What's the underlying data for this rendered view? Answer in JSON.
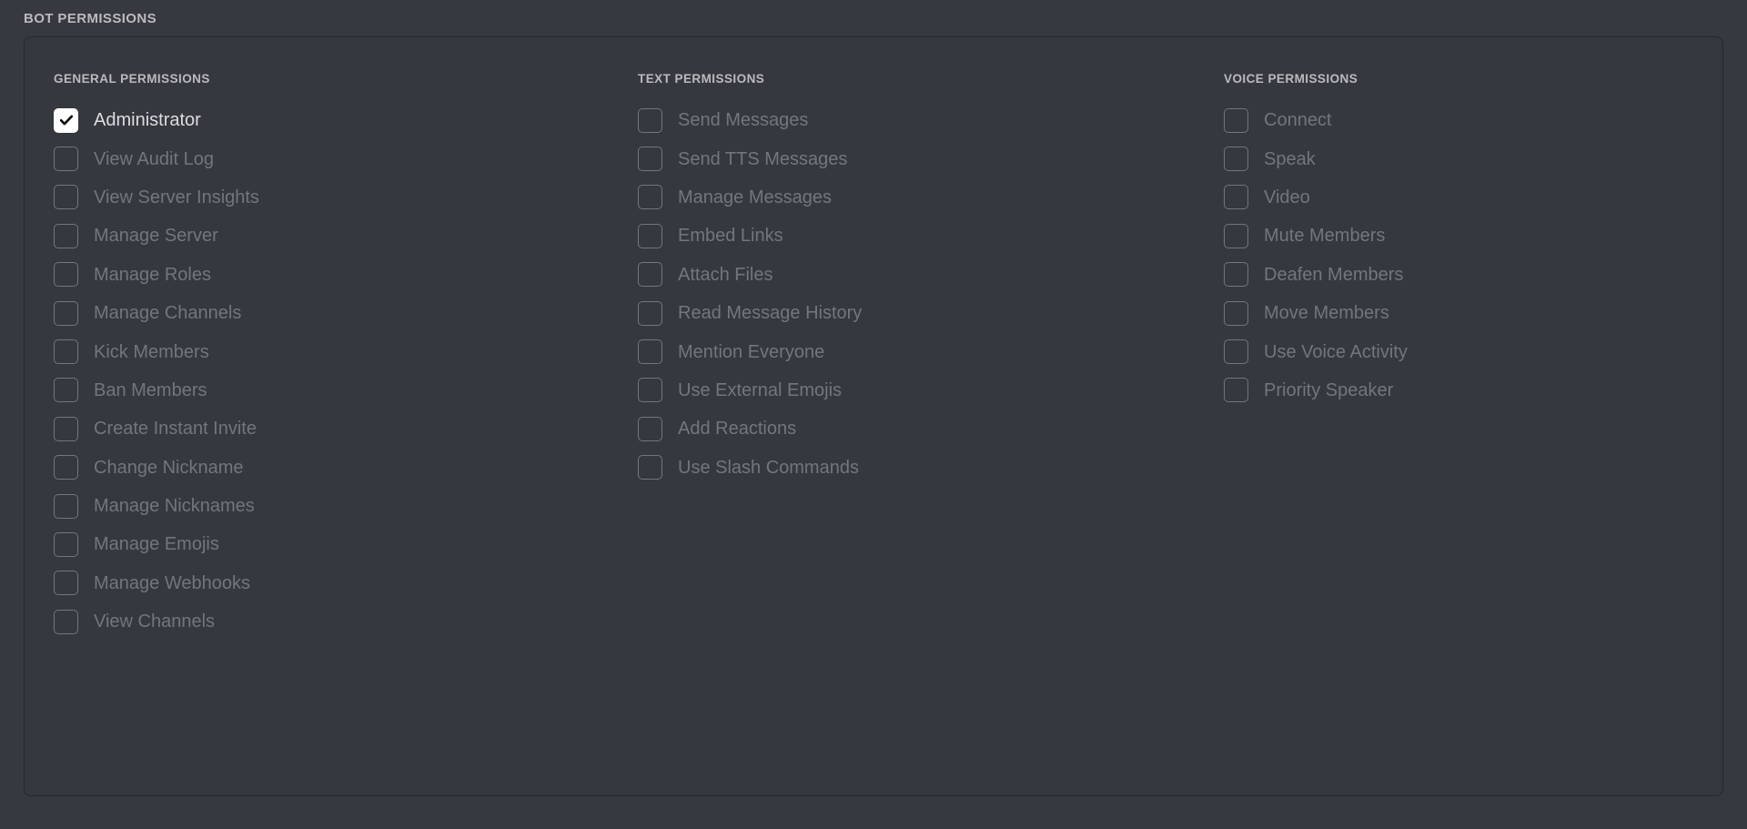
{
  "section": {
    "title": "BOT PERMISSIONS"
  },
  "colors": {
    "page_background": "#36393f",
    "panel_background": "#35383e",
    "panel_border": "#26282c",
    "heading_text": "#b9bbbe",
    "label_disabled": "#72767d",
    "label_enabled": "#dcddde",
    "checkbox_border": "#72767d",
    "checkbox_checked_fill": "#ffffff",
    "checkmark": "#000000"
  },
  "columns": [
    {
      "heading": "GENERAL PERMISSIONS",
      "items": [
        {
          "label": "Administrator",
          "checked": true
        },
        {
          "label": "View Audit Log",
          "checked": false
        },
        {
          "label": "View Server Insights",
          "checked": false
        },
        {
          "label": "Manage Server",
          "checked": false
        },
        {
          "label": "Manage Roles",
          "checked": false
        },
        {
          "label": "Manage Channels",
          "checked": false
        },
        {
          "label": "Kick Members",
          "checked": false
        },
        {
          "label": "Ban Members",
          "checked": false
        },
        {
          "label": "Create Instant Invite",
          "checked": false
        },
        {
          "label": "Change Nickname",
          "checked": false
        },
        {
          "label": "Manage Nicknames",
          "checked": false
        },
        {
          "label": "Manage Emojis",
          "checked": false
        },
        {
          "label": "Manage Webhooks",
          "checked": false
        },
        {
          "label": "View Channels",
          "checked": false
        }
      ]
    },
    {
      "heading": "TEXT PERMISSIONS",
      "items": [
        {
          "label": "Send Messages",
          "checked": false
        },
        {
          "label": "Send TTS Messages",
          "checked": false
        },
        {
          "label": "Manage Messages",
          "checked": false
        },
        {
          "label": "Embed Links",
          "checked": false
        },
        {
          "label": "Attach Files",
          "checked": false
        },
        {
          "label": "Read Message History",
          "checked": false
        },
        {
          "label": "Mention Everyone",
          "checked": false
        },
        {
          "label": "Use External Emojis",
          "checked": false
        },
        {
          "label": "Add Reactions",
          "checked": false
        },
        {
          "label": "Use Slash Commands",
          "checked": false
        }
      ]
    },
    {
      "heading": "VOICE PERMISSIONS",
      "items": [
        {
          "label": "Connect",
          "checked": false
        },
        {
          "label": "Speak",
          "checked": false
        },
        {
          "label": "Video",
          "checked": false
        },
        {
          "label": "Mute Members",
          "checked": false
        },
        {
          "label": "Deafen Members",
          "checked": false
        },
        {
          "label": "Move Members",
          "checked": false
        },
        {
          "label": "Use Voice Activity",
          "checked": false
        },
        {
          "label": "Priority Speaker",
          "checked": false
        }
      ]
    }
  ]
}
